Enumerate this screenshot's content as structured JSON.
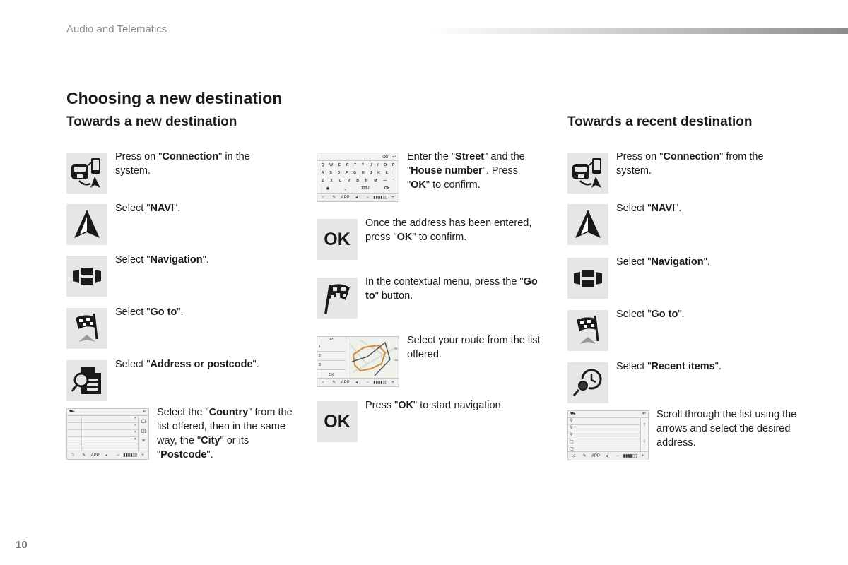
{
  "header": {
    "section_label": "Audio and Telematics"
  },
  "page_title": "Choosing a new destination",
  "new_destination": {
    "title": "Towards a new destination",
    "steps": [
      {
        "icon": "connection-icon",
        "pre": "Press on \"",
        "bold": "Connection",
        "post": "\" in the system."
      },
      {
        "icon": "navi-arrow-icon",
        "pre": "Select \"",
        "bold": "NAVI",
        "post": "\"."
      },
      {
        "icon": "navigation-icon",
        "pre": "Select \"",
        "bold": "Navigation",
        "post": "\"."
      },
      {
        "icon": "go-to-flag-icon",
        "pre": "Select \"",
        "bold": "Go to",
        "post": "\"."
      },
      {
        "icon": "address-search-icon",
        "pre": "Select \"",
        "bold": "Address or postcode",
        "post": "\"."
      },
      {
        "icon": "country-list-screen",
        "parts": [
          {
            "t": "Select the \""
          },
          {
            "b": "Country"
          },
          {
            "t": "\" from the list offered, then in the same way, the \""
          },
          {
            "b": "City"
          },
          {
            "t": "\" or its \""
          },
          {
            "b": "Postcode"
          },
          {
            "t": "\"."
          }
        ]
      }
    ],
    "steps_col2": [
      {
        "icon": "keyboard-screen",
        "parts": [
          {
            "t": "Enter the \""
          },
          {
            "b": "Street"
          },
          {
            "t": "\" and the \""
          },
          {
            "b": "House number"
          },
          {
            "t": "\". Press \""
          },
          {
            "b": "OK"
          },
          {
            "t": "\" to confirm."
          }
        ]
      },
      {
        "icon": "ok-icon",
        "parts": [
          {
            "t": "Once the address has been entered, press \""
          },
          {
            "b": "OK"
          },
          {
            "t": "\" to confirm."
          }
        ]
      },
      {
        "icon": "flag-icon",
        "parts": [
          {
            "t": "In the contextual menu, press the \""
          },
          {
            "b": "Go to"
          },
          {
            "t": "\" button."
          }
        ]
      },
      {
        "icon": "route-map-screen",
        "parts": [
          {
            "t": "Select your route from the list offered."
          }
        ]
      },
      {
        "icon": "ok-icon",
        "parts": [
          {
            "t": "Press \""
          },
          {
            "b": "OK"
          },
          {
            "t": "\" to start navigation."
          }
        ]
      }
    ]
  },
  "recent_destination": {
    "title": "Towards a recent destination",
    "steps": [
      {
        "icon": "connection-icon",
        "pre": "Press on \"",
        "bold": "Connection",
        "post": "\" from the system."
      },
      {
        "icon": "navi-arrow-icon",
        "pre": "Select \"",
        "bold": "NAVI",
        "post": "\"."
      },
      {
        "icon": "navigation-icon",
        "pre": "Select \"",
        "bold": "Navigation",
        "post": "\"."
      },
      {
        "icon": "go-to-flag-icon",
        "pre": "Select \"",
        "bold": "Go to",
        "post": "\"."
      },
      {
        "icon": "recent-items-icon",
        "pre": "Select \"",
        "bold": "Recent items",
        "post": "\"."
      },
      {
        "icon": "recent-list-screen",
        "pre": "Scroll through the list using the arrows and select the desired address.",
        "bold": "",
        "post": ""
      }
    ]
  },
  "ok_label": "OK",
  "screen": {
    "bottom_bar": [
      "♫",
      "✎",
      "APP",
      "◂",
      "−",
      "▮▮▮▮▯▯",
      "+"
    ],
    "keyboard_rows": [
      [
        "Q",
        "W",
        "E",
        "R",
        "T",
        "Y",
        "U",
        "I",
        "O",
        "P"
      ],
      [
        "A",
        "S",
        "D",
        "F",
        "G",
        "H",
        "J",
        "K",
        "L",
        "/"
      ],
      [
        "Z",
        "X",
        "C",
        "V",
        "B",
        "N",
        "M",
        "—",
        "'"
      ],
      [
        "◉",
        "⎵",
        "123-/",
        "OK"
      ]
    ],
    "route_rows": [
      "1",
      "2",
      "3"
    ],
    "route_ok": "OK"
  },
  "page_number": "10"
}
